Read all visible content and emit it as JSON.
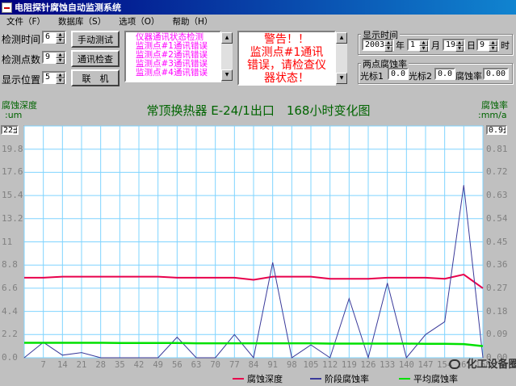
{
  "window": {
    "title": "电阻探针腐蚀自动监测系统"
  },
  "menu": [
    "文件（F）",
    "数据库（S）",
    "选项（O）",
    "帮助（H）"
  ],
  "controls": {
    "interval_label": "检测时间",
    "interval_value": "6",
    "points_label": "检测点数",
    "points_value": "9",
    "display_label": "显示位置",
    "display_value": "5",
    "manual_test_button": "手动测试",
    "comm_check_button": "通讯检查",
    "online_button": "联　机"
  },
  "comm_status": {
    "lines": [
      "仪器通讯状态检测",
      "监测点#1通讯错误",
      "监测点#2通讯错误",
      "监测点#3通讯错误",
      "监测点#4通讯错误"
    ]
  },
  "alert": {
    "lines": [
      "警告！！",
      "监测点#1通讯",
      "错误，请检查仪",
      "器状态！"
    ]
  },
  "display_time": {
    "title": "显示时间",
    "year": "2003",
    "year_label": "年",
    "month": "1",
    "month_label": "月",
    "day": "19",
    "day_label": "日",
    "hour": "9",
    "hour_label": "时"
  },
  "two_point": {
    "title": "两点腐蚀率",
    "cursor1_label": "光标1",
    "cursor1_value": "0.0",
    "cursor2_label": "光标2",
    "cursor2_value": "0.0",
    "rate_label": "腐蚀率",
    "rate_value": "0.00"
  },
  "chart_data": {
    "type": "line",
    "title": "常顶换热器 E-24/1出口　168小时变化图",
    "left_axis_name": "腐蚀深度",
    "left_axis_unit": ":um",
    "right_axis_name": "腐蚀率",
    "right_axis_unit": ":mm/a",
    "left_max_box": "22",
    "right_max_box": "0.9",
    "y_left_ticks": [
      "19.8",
      "17.6",
      "15.4",
      "13.2",
      "11",
      "8.8",
      "6.6",
      "4.4",
      "2.2",
      "0.0"
    ],
    "y_right_ticks": [
      "0.81",
      "0.72",
      "0.63",
      "0.54",
      "0.45",
      "0.36",
      "0.27",
      "0.18",
      "0.09",
      "0.00"
    ],
    "x_ticks": [
      "0",
      "7",
      "14",
      "21",
      "28",
      "35",
      "42",
      "49",
      "56",
      "63",
      "70",
      "77",
      "84",
      "91",
      "98",
      "105",
      "112",
      "119",
      "126",
      "133",
      "140",
      "147",
      "154",
      "161",
      "168"
    ],
    "ylim_left": [
      0,
      22
    ],
    "ylim_right": [
      0,
      0.9
    ],
    "xlim": [
      0,
      168
    ],
    "grid": true,
    "series": [
      {
        "name": "腐蚀深度",
        "color": "#e8004c",
        "axis": "left",
        "x": [
          0,
          7,
          14,
          21,
          28,
          35,
          42,
          49,
          56,
          63,
          70,
          77,
          84,
          91,
          98,
          105,
          112,
          119,
          126,
          133,
          140,
          147,
          154,
          161,
          168
        ],
        "values": [
          7.6,
          7.6,
          7.7,
          7.7,
          7.7,
          7.7,
          7.7,
          7.7,
          7.6,
          7.6,
          7.6,
          7.6,
          7.4,
          7.7,
          7.7,
          7.7,
          7.5,
          7.5,
          7.5,
          7.6,
          7.6,
          7.6,
          7.5,
          7.9,
          6.6
        ]
      },
      {
        "name": "阶段腐蚀率",
        "color": "#3a3a9a",
        "axis": "right",
        "x": [
          0,
          7,
          14,
          21,
          28,
          35,
          42,
          49,
          56,
          63,
          70,
          77,
          84,
          91,
          98,
          105,
          112,
          119,
          126,
          133,
          140,
          147,
          154,
          161,
          168
        ],
        "values": [
          0.0,
          0.06,
          0.01,
          0.02,
          0.0,
          0.0,
          0.0,
          0.0,
          0.08,
          0.0,
          0.0,
          0.09,
          0.0,
          0.37,
          0.0,
          0.05,
          0.0,
          0.23,
          0.0,
          0.29,
          0.0,
          0.09,
          0.14,
          0.67,
          0.0
        ]
      },
      {
        "name": "平均腐蚀率",
        "color": "#00e000",
        "axis": "right",
        "x": [
          0,
          7,
          14,
          21,
          28,
          35,
          42,
          49,
          56,
          63,
          70,
          77,
          84,
          91,
          98,
          105,
          112,
          119,
          126,
          133,
          140,
          147,
          154,
          161,
          168
        ],
        "values": [
          0.058,
          0.058,
          0.058,
          0.058,
          0.058,
          0.057,
          0.057,
          0.057,
          0.057,
          0.056,
          0.056,
          0.056,
          0.056,
          0.056,
          0.056,
          0.056,
          0.055,
          0.055,
          0.055,
          0.055,
          0.055,
          0.054,
          0.054,
          0.053,
          0.045
        ]
      }
    ],
    "legend": "bottom"
  },
  "watermark": "化工设备圈"
}
